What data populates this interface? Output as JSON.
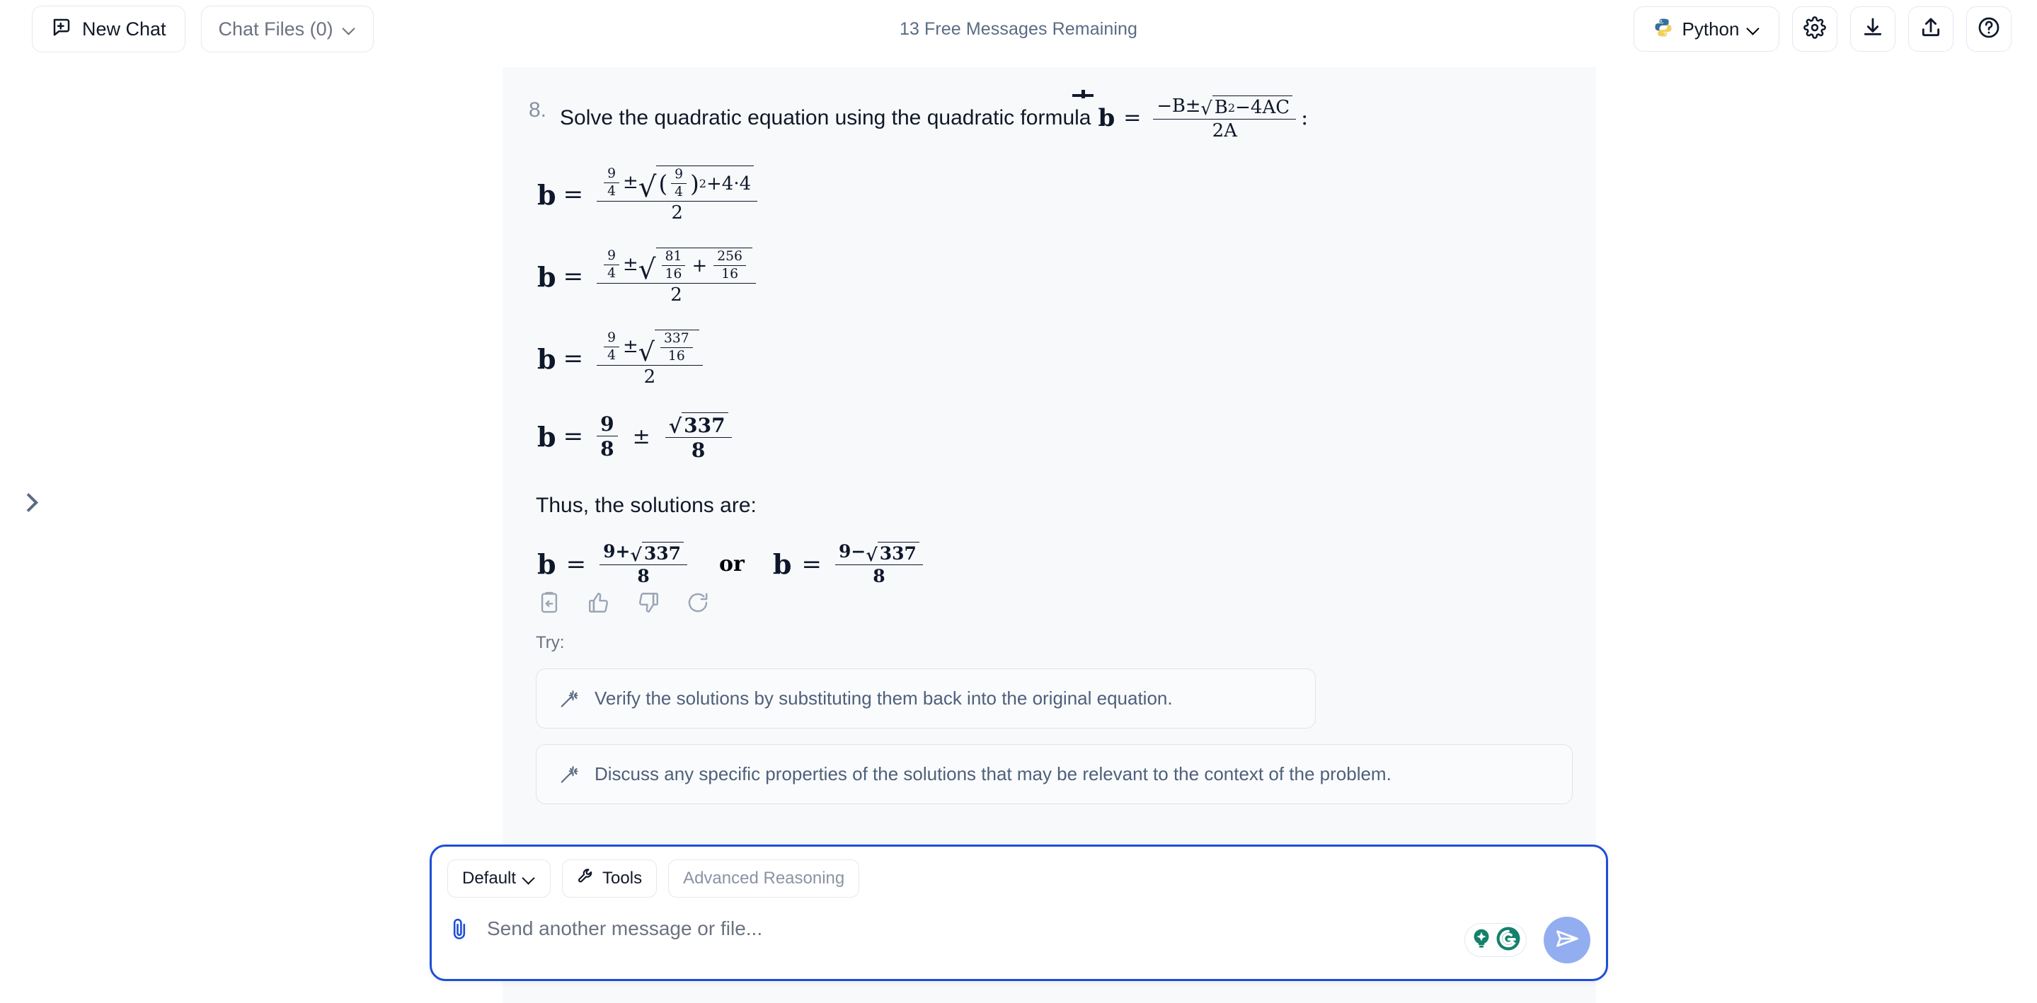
{
  "topbar": {
    "new_chat_label": "New Chat",
    "new_chat_icon": "chat-plus-icon",
    "chat_files_label": "Chat Files (0)",
    "chat_files_chevron": "chevron-down-icon",
    "free_messages": "13 Free Messages Remaining",
    "language_label": "Python",
    "language_icon": "python-logo-icon",
    "settings_icon": "gear-icon",
    "download_icon": "download-icon",
    "share_icon": "share-upload-icon",
    "help_icon": "question-circle-icon"
  },
  "sidebar": {
    "toggle_icon": "chevron-right-icon"
  },
  "message": {
    "step_number": "8.",
    "step_text": "Solve the quadratic equation using the quadratic formula",
    "formula_var": "b",
    "formula_eq": "=",
    "formula_numerator": "−B±√B²−4AC",
    "formula_denominator": "2A",
    "formula_colon": ":",
    "equations": [
      {
        "lhs": "b",
        "eq": "=",
        "numerator_lead": "9/4 ±",
        "radicand": "(9/4)² + 4·4",
        "denominator": "2",
        "plain": "b = ( 9/4 ± √((9/4)² + 4·4) ) / 2"
      },
      {
        "lhs": "b",
        "eq": "=",
        "numerator_lead": "9/4 ±",
        "radicand": "81/16 + 256/16",
        "denominator": "2",
        "plain": "b = ( 9/4 ± √(81/16 + 256/16) ) / 2"
      },
      {
        "lhs": "b",
        "eq": "=",
        "numerator_lead": "9/4 ±",
        "radicand": "337/16",
        "denominator": "2",
        "plain": "b = ( 9/4 ± √(337/16) ) / 2"
      },
      {
        "lhs": "b",
        "eq": "=",
        "term1_num": "9",
        "term1_den": "8",
        "pm": "±",
        "term2_num": "√337",
        "term2_den": "8",
        "plain": "b = 9/8 ± √337/8"
      }
    ],
    "thus_text": "Thus, the solutions are:",
    "solutions": {
      "left_lhs": "b",
      "left_eq": "=",
      "left_num": "9+√337",
      "left_den": "8",
      "or": "or",
      "right_lhs": "b",
      "right_eq": "=",
      "right_num": "9−√337",
      "right_den": "8"
    },
    "actions": [
      {
        "name": "copy-icon",
        "label": "Copy"
      },
      {
        "name": "thumbs-up-icon",
        "label": "Good response"
      },
      {
        "name": "thumbs-down-icon",
        "label": "Bad response"
      },
      {
        "name": "regenerate-icon",
        "label": "Regenerate"
      }
    ],
    "try_label": "Try:",
    "suggestions": [
      {
        "icon": "sparkle-wand-icon",
        "text": "Verify the solutions by substituting them back into the original equation."
      },
      {
        "icon": "sparkle-wand-icon",
        "text": "Discuss any specific properties of the solutions that may be relevant to the context of the problem."
      }
    ]
  },
  "composer": {
    "mode_label": "Default",
    "mode_chevron": "chevron-down-icon",
    "tools_label": "Tools",
    "tools_icon": "wrench-icon",
    "advanced_label": "Advanced Reasoning",
    "attach_icon": "paperclip-icon",
    "placeholder": "Send another message or file...",
    "grammarly_bulb_icon": "bulb-sparkle-icon",
    "grammarly_icon": "grammarly-g-icon",
    "send_icon": "send-paper-plane-icon"
  },
  "colors": {
    "accent_blue": "#1d4ed8",
    "send_button": "#93aef0",
    "panel_bg": "#f7f9fb",
    "muted_text": "#6b7280",
    "math_text": "#0f172a",
    "grammarly_green": "#15806c"
  },
  "math_glyphs": {
    "nine": "9",
    "four": "4",
    "two": "2",
    "eight": "8",
    "eightyone": "81",
    "sixteen": "16",
    "twofivesix": "256",
    "threethreeseven": "337",
    "sup2": "2",
    "fourdotfour": "4·4",
    "pm": "±",
    "plus": "+",
    "minus": "−",
    "radical": "√",
    "eq": "=",
    "b": "b",
    "A": "A",
    "B": "B",
    "C": "C",
    "negB": "−B",
    "Bsq": "B",
    "m4AC": "−4AC",
    "twoA": "2A",
    "lparen": "(",
    "rparen": ")"
  }
}
